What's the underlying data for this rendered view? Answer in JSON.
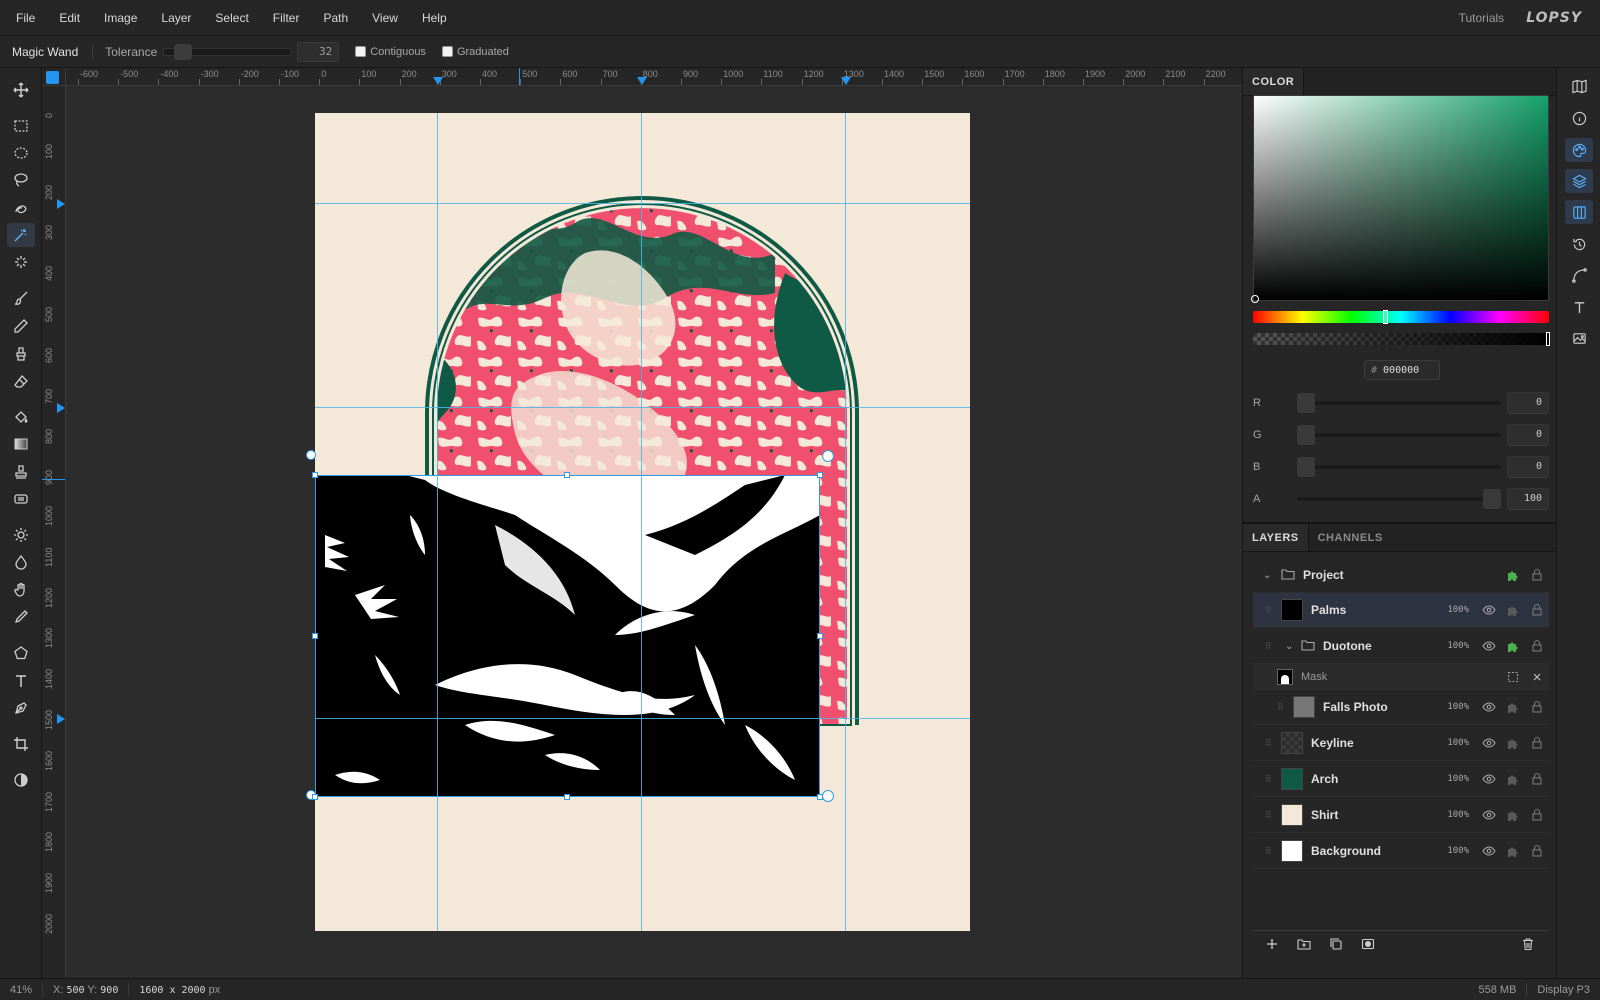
{
  "menubar": {
    "items": [
      "File",
      "Edit",
      "Image",
      "Layer",
      "Select",
      "Filter",
      "Path",
      "View",
      "Help"
    ],
    "tutorials": "Tutorials",
    "logo": "LOPSY"
  },
  "options": {
    "tool_name": "Magic Wand",
    "tolerance_label": "Tolerance",
    "tolerance_value": "32",
    "contiguous_label": "Contiguous",
    "graduated_label": "Graduated"
  },
  "toolbox": {
    "active_tool": "magic-wand",
    "tools": [
      "move",
      "rect-select",
      "ellipse-select",
      "lasso",
      "quick-select",
      "magic-wand",
      "sparkle",
      "brush",
      "pencil",
      "clone",
      "eraser",
      "fill",
      "gradient",
      "stamp",
      "patch",
      "dodge",
      "burn",
      "hand",
      "eyedropper",
      "shape",
      "text",
      "pen",
      "crop",
      "contrast"
    ]
  },
  "rulers": {
    "top": [
      "-600",
      "-500",
      "-400",
      "-300",
      "-200",
      "-100",
      "0",
      "100",
      "200",
      "300",
      "400",
      "500",
      "600",
      "700",
      "800",
      "900",
      "1000",
      "1100",
      "1200",
      "1300",
      "1400",
      "1500",
      "1600",
      "1700",
      "1800",
      "1900",
      "2000",
      "2100",
      "2200"
    ],
    "left": [
      "0",
      "100",
      "200",
      "300",
      "400",
      "500",
      "600",
      "700",
      "800",
      "900",
      "1000",
      "1100",
      "1200",
      "1300",
      "1400",
      "1500",
      "1600",
      "1700",
      "1800",
      "1900",
      "2000"
    ]
  },
  "statusbar": {
    "zoom": "41%",
    "x_label": "X:",
    "x_value": "500",
    "y_label": "Y:",
    "y_value": "900",
    "size": "1600 x 2000",
    "size_unit": "px",
    "memory": "558 MB",
    "profile": "Display P3"
  },
  "color_panel": {
    "tab": "COLOR",
    "hex_prefix": "#",
    "hex": "000000",
    "hue_value_percent": 44,
    "channels": [
      {
        "label": "R",
        "value": "0"
      },
      {
        "label": "G",
        "value": "0"
      },
      {
        "label": "B",
        "value": "0"
      },
      {
        "label": "A",
        "value": "100"
      }
    ],
    "gradient_color": "#16a06c"
  },
  "layers_panel": {
    "tabs": [
      "LAYERS",
      "CHANNELS"
    ],
    "layers": [
      {
        "name": "Project",
        "opacity": "",
        "kind": "group-root"
      },
      {
        "name": "Palms",
        "opacity": "100%",
        "kind": "layer",
        "selected": true
      },
      {
        "name": "Duotone",
        "opacity": "100%",
        "kind": "group"
      },
      {
        "name": "Mask",
        "opacity": "",
        "kind": "mask"
      },
      {
        "name": "Falls Photo",
        "opacity": "100%",
        "kind": "layer"
      },
      {
        "name": "Keyline",
        "opacity": "100%",
        "kind": "layer"
      },
      {
        "name": "Arch",
        "opacity": "100%",
        "kind": "layer"
      },
      {
        "name": "Shirt",
        "opacity": "100%",
        "kind": "layer"
      },
      {
        "name": "Background",
        "opacity": "100%",
        "kind": "layer"
      }
    ]
  },
  "colors": {
    "accent": "#2196f3",
    "guide": "#4ab6e8",
    "arch_green": "#0f5a44",
    "arch_pink": "#f0506e",
    "shirt": "#f4e9d8"
  }
}
